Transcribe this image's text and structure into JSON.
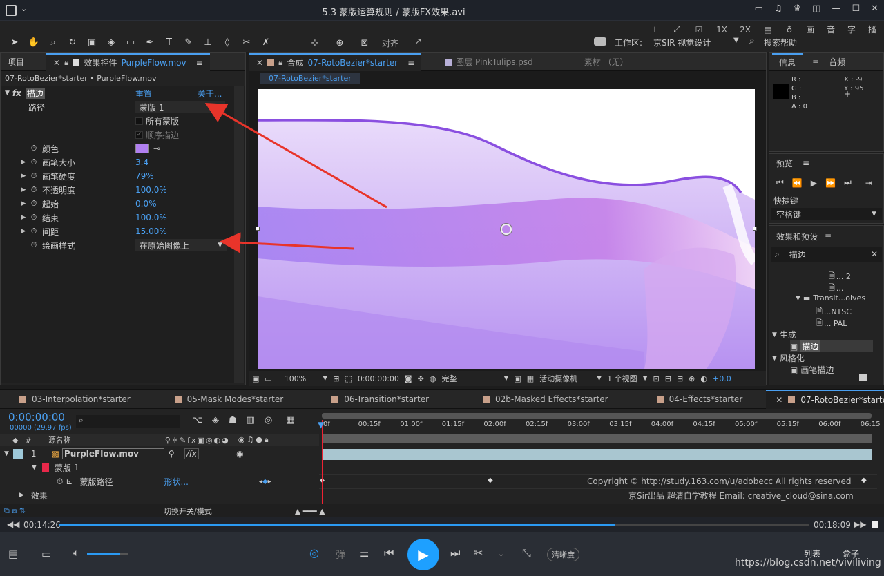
{
  "window": {
    "title": "5.3 蒙版运算规则 / 蒙版FX效果.avi"
  },
  "toolbar": {
    "align_label": "对齐",
    "workspace_label": "工作区:",
    "workspace_value": "京SIR 视觉设计",
    "search_help": "搜索帮助",
    "right_items": [
      "1X",
      "2X",
      "画",
      "音",
      "字",
      "播"
    ]
  },
  "left_panel": {
    "tab_project": "项目",
    "tab_effects_label": "效果控件",
    "tab_effects_file": "PurpleFlow.mov",
    "breadcrumb": "07-RotoBezier*starter • PurpleFlow.mov",
    "effect": {
      "fx": "fx",
      "name": "描边",
      "reset": "重置",
      "about": "关于..."
    },
    "props": {
      "path_label": "路径",
      "path_value": "蒙版 1",
      "all_masks": "所有蒙版",
      "sequential": "顺序描边",
      "color_label": "颜色",
      "brush_size_label": "画笔大小",
      "brush_size_value": "3.4",
      "brush_hardness_label": "画笔硬度",
      "brush_hardness_value": "79%",
      "opacity_label": "不透明度",
      "opacity_value": "100.0%",
      "start_label": "起始",
      "start_value": "0.0%",
      "end_label": "结束",
      "end_value": "100.0%",
      "spacing_label": "间距",
      "spacing_value": "15.00%",
      "paint_style_label": "绘画样式",
      "paint_style_value": "在原始图像上"
    }
  },
  "center_panel": {
    "tab_comp_label": "合成",
    "tab_comp_name": "07-RotoBezier*starter",
    "tab_layer": "图层 PinkTulips.psd",
    "tab_footage": "素材 （无）",
    "comp_chip": "07-RotoBezier*starter",
    "zoom": "100%",
    "timecode": "0:00:00:00",
    "quality": "完整",
    "camera": "活动摄像机",
    "views": "1 个视图",
    "exposure": "+0.0"
  },
  "right_panel": {
    "info_tab": "信息",
    "audio_tab": "音频",
    "rgba": [
      "R :",
      "G :",
      "B :",
      "A : 0"
    ],
    "x": "X : -9",
    "y": "Y : 95",
    "preview_title": "预览",
    "shortcut_label": "快捷键",
    "shortcut_value": "空格键",
    "effects_title": "效果和预设",
    "search_value": "描边",
    "tree": [
      "... 2",
      "...",
      "Transit...olves",
      "...NTSC",
      "... PAL",
      "生成",
      "描边",
      "风格化",
      "画笔描边"
    ]
  },
  "timeline": {
    "tabs": [
      "03-Interpolation*starter",
      "05-Mask Modes*starter",
      "06-Transition*starter",
      "02b-Masked Effects*starter",
      "04-Effects*starter",
      "07-RotoBezier*starter"
    ],
    "timecode": "0:00:00:00",
    "fps": "00000 (29.97 fps)",
    "source_name_header": "源名称",
    "hash_header": "#",
    "ruler": [
      "0f",
      "00:15f",
      "01:00f",
      "01:15f",
      "02:00f",
      "02:15f",
      "03:00f",
      "03:15f",
      "04:00f",
      "04:15f",
      "05:00f",
      "05:15f",
      "06:00f",
      "06:15"
    ],
    "layer_num": "1",
    "layer_name": "PurpleFlow.mov",
    "mask_label": "蒙版",
    "mask_num": "1",
    "mask_path_label": "蒙版路径",
    "mask_path_value": "形状...",
    "effects_label": "效果",
    "toggle_label": "切换开关/模式",
    "watermark_line1": "Copyright © http://study.163.com/u/adobecc All rights reserved",
    "watermark_line2": "京Sir出品  超清自学教程 Email: creative_cloud@sina.com"
  },
  "player": {
    "elapsed": "00:14:26",
    "total": "00:18:09",
    "progress": 0.74,
    "volume": 0.8,
    "bullet_label": "弹",
    "clarity_label": "清晰度",
    "list_label": "列表",
    "box_label": "盒子",
    "url": "https://blog.csdn.net/viviliving"
  }
}
